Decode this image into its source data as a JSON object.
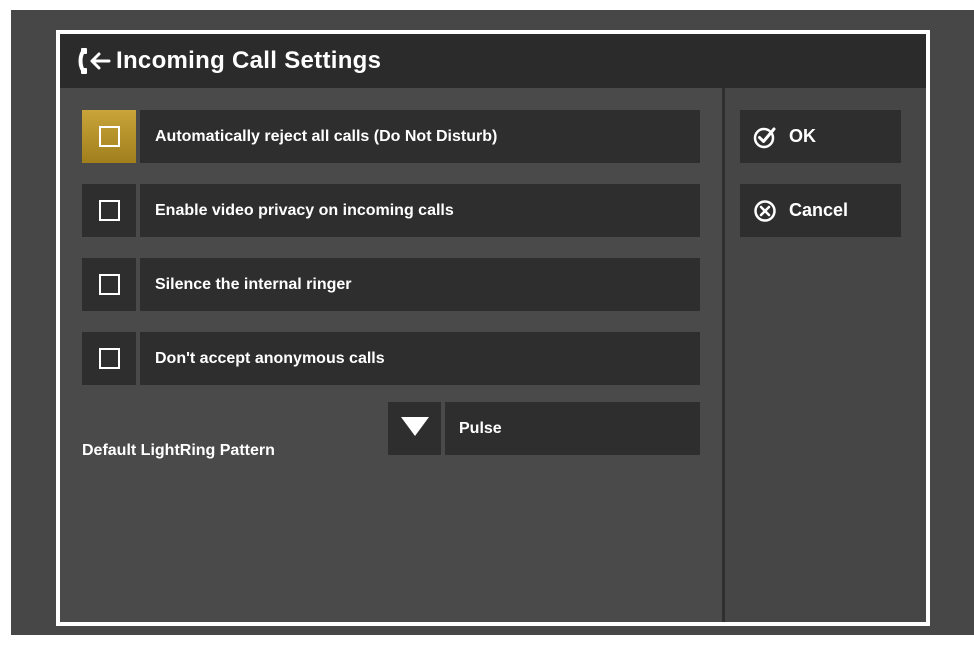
{
  "dialog": {
    "title": "Incoming Call Settings",
    "title_icon": "incoming-call-icon"
  },
  "options": [
    {
      "label": "Automatically reject all calls (Do Not Disturb)",
      "checked": false,
      "focused": true
    },
    {
      "label": "Enable video privacy on incoming calls",
      "checked": false,
      "focused": false
    },
    {
      "label": "Silence the internal ringer",
      "checked": false,
      "focused": false
    },
    {
      "label": "Don't accept anonymous calls",
      "checked": false,
      "focused": false
    }
  ],
  "lightring": {
    "label": "Default LightRing Pattern",
    "value": "Pulse",
    "dropdown_icon": "triangle-down-icon"
  },
  "buttons": {
    "ok": {
      "label": "OK",
      "icon": "check-circle-icon"
    },
    "cancel": {
      "label": "Cancel",
      "icon": "x-circle-icon"
    }
  },
  "colors": {
    "focus_accent": "#b8932a",
    "control_bg": "#2e2e2e",
    "dialog_bg": "#4a4a4a",
    "titlebar_bg": "#2b2b2b"
  }
}
